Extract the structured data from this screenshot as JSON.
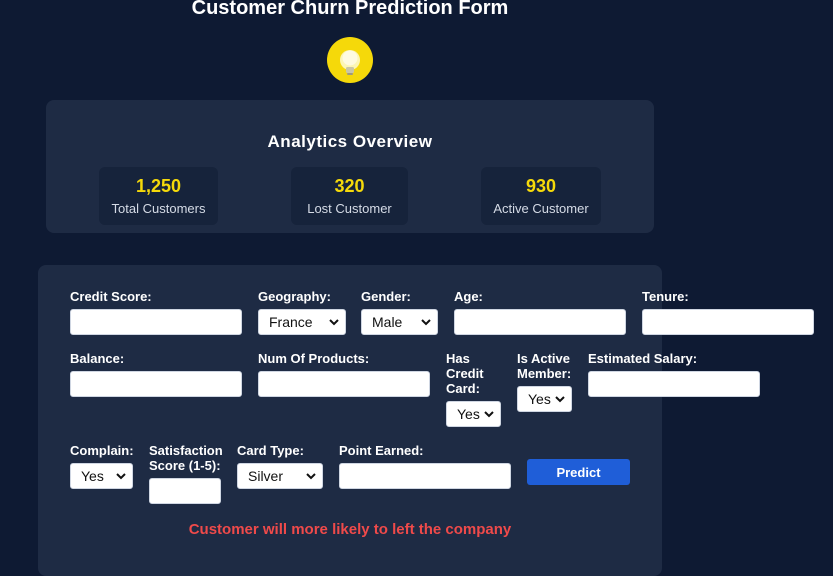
{
  "header": {
    "title": "Customer Churn Prediction Form",
    "icon": "lightbulb-icon"
  },
  "analytics": {
    "title": "Analytics Overview",
    "stats": [
      {
        "value": "1,250",
        "label": "Total Customers"
      },
      {
        "value": "320",
        "label": "Lost Customer"
      },
      {
        "value": "930",
        "label": "Active Customer"
      }
    ]
  },
  "form": {
    "credit_score": {
      "label": "Credit Score:",
      "value": ""
    },
    "geography": {
      "label": "Geography:",
      "value": "France"
    },
    "gender": {
      "label": "Gender:",
      "value": "Male"
    },
    "age": {
      "label": "Age:",
      "value": ""
    },
    "tenure": {
      "label": "Tenure:",
      "value": ""
    },
    "balance": {
      "label": "Balance:",
      "value": ""
    },
    "num_products": {
      "label": "Num Of Products:",
      "value": ""
    },
    "has_credit_card": {
      "label": [
        "Has",
        "Credit",
        "Card:"
      ],
      "value": "Yes"
    },
    "is_active_member": {
      "label": [
        "Is Active",
        "Member:"
      ],
      "value": "Yes"
    },
    "estimated_salary": {
      "label": "Estimated Salary:",
      "value": ""
    },
    "complain": {
      "label": "Complain:",
      "value": "Yes"
    },
    "satisfaction_score": {
      "label": [
        "Satisfaction",
        "Score (1-5):"
      ],
      "value": ""
    },
    "card_type": {
      "label": "Card Type:",
      "value": "Silver"
    },
    "point_earned": {
      "label": "Point Earned:",
      "value": ""
    },
    "predict_label": "Predict"
  },
  "result": {
    "message": "Customer will more likely to left the company",
    "color": "#ef4a4a"
  },
  "colors": {
    "background": "#0e1a33",
    "card": "#1e2b44",
    "accent": "#f5d90a",
    "button": "#1f5ed8"
  }
}
